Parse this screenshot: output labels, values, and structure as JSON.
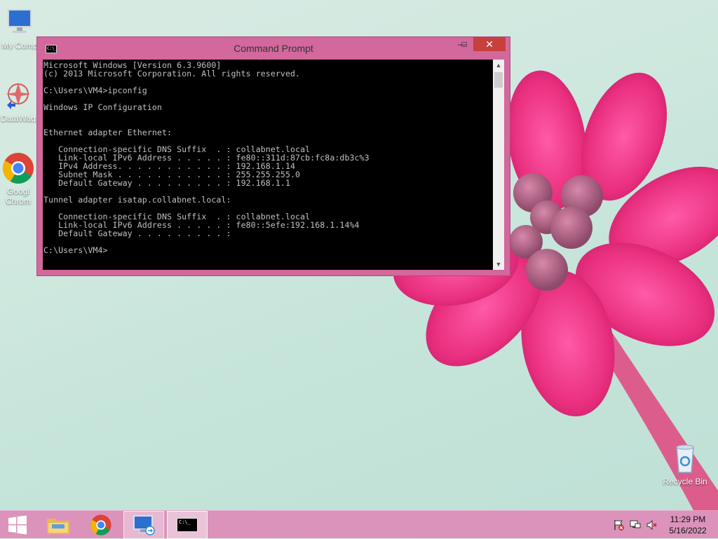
{
  "desktop": {
    "icons": [
      {
        "label": "My Comp"
      },
      {
        "label": "DataWag"
      },
      {
        "label": "Googl",
        "label2": "Chrom"
      },
      {
        "label": "Recycle Bin"
      }
    ]
  },
  "window": {
    "title": "Command Prompt",
    "title_icon_text": "C:\\_",
    "min_glyph": "—",
    "max_glyph": "□",
    "close_glyph": "✕",
    "console_lines": [
      "Microsoft Windows [Version 6.3.9600]",
      "(c) 2013 Microsoft Corporation. All rights reserved.",
      "",
      "C:\\Users\\VM4>ipconfig",
      "",
      "Windows IP Configuration",
      "",
      "",
      "Ethernet adapter Ethernet:",
      "",
      "   Connection-specific DNS Suffix  . : collabnet.local",
      "   Link-local IPv6 Address . . . . . : fe80::311d:87cb:fc8a:db3c%3",
      "   IPv4 Address. . . . . . . . . . . : 192.168.1.14",
      "   Subnet Mask . . . . . . . . . . . : 255.255.255.0",
      "   Default Gateway . . . . . . . . . : 192.168.1.1",
      "",
      "Tunnel adapter isatap.collabnet.local:",
      "",
      "   Connection-specific DNS Suffix  . : collabnet.local",
      "   Link-local IPv6 Address . . . . . : fe80::5efe:192.168.1.14%4",
      "   Default Gateway . . . . . . . . . :",
      "",
      "C:\\Users\\VM4>"
    ]
  },
  "taskbar": {
    "cmd_icon_text": "C:\\_",
    "clock_time": "11:29 PM",
    "clock_date": "5/16/2022"
  },
  "colors": {
    "titlebar": "#d2689b",
    "close_button": "#c7403d",
    "taskbar": "#dd8cb9",
    "console_bg": "#000000",
    "console_fg": "#c0c0c0"
  },
  "icons": {
    "computer": "computer-icon",
    "datawag": "datawag-icon",
    "chrome": "chrome-icon",
    "recycle": "recycle-bin-icon",
    "start": "windows-logo-icon",
    "explorer": "folder-icon",
    "rdp": "remote-desktop-icon",
    "cmd": "command-prompt-icon",
    "flag": "action-center-flag-icon",
    "network": "network-icon",
    "volume": "volume-muted-icon"
  }
}
